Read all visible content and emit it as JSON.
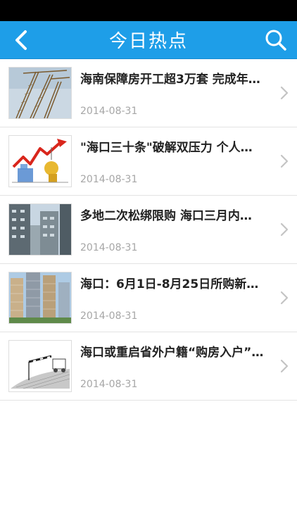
{
  "app": {
    "title": "今日热点",
    "colors": {
      "appbar": "#1e9ee8",
      "statusbar": "#000000",
      "date": "#a6a6a6",
      "divider": "#e3e3e3"
    },
    "icons": {
      "back": "chevron-left-icon",
      "search": "search-icon",
      "row_arrow": "chevron-right-icon"
    }
  },
  "news": [
    {
      "headline": "海南保障房开工超3万套 完成年…",
      "date": "2014-08-31",
      "thumb": "construction-cranes"
    },
    {
      "headline": "\"海口三十条\"破解双压力 个人…",
      "date": "2014-08-31",
      "thumb": "price-chart-illustration"
    },
    {
      "headline": "多地二次松绑限购 海口三月内…",
      "date": "2014-08-31",
      "thumb": "apartment-towers"
    },
    {
      "headline": "海口：6月1日-8月25日所购新…",
      "date": "2014-08-31",
      "thumb": "high-rise-buildings"
    },
    {
      "headline": "海口或重启省外户籍“购房入户”…",
      "date": "2014-08-31",
      "thumb": "road-barrier-sketch"
    }
  ]
}
